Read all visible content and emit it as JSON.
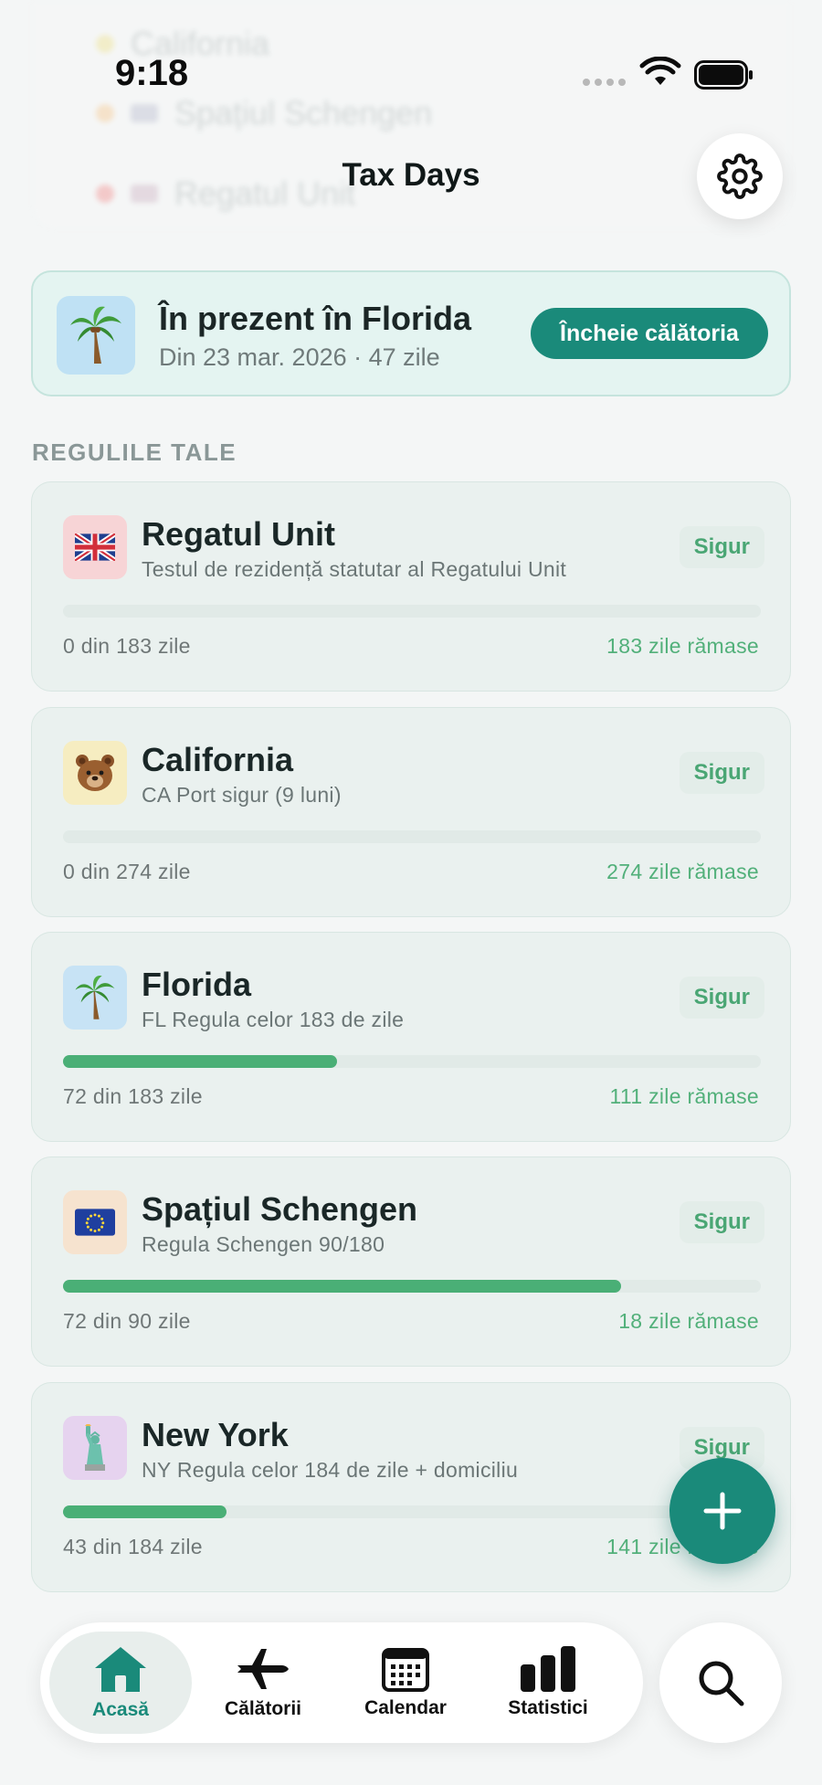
{
  "status_bar": {
    "time": "9:18"
  },
  "background_list": [
    {
      "name": "California",
      "value": ""
    },
    {
      "name": "Spațiul Schengen",
      "value": ""
    },
    {
      "name": "Regatul Unit",
      "value": ""
    }
  ],
  "header": {
    "title": "Tax Days"
  },
  "current": {
    "title": "În prezent în Florida",
    "subtitle": "Din 23 mar. 2026 · 47 zile",
    "end_button": "Încheie călătoria",
    "icon": "palm-tree-icon"
  },
  "section_title": "REGULILE TALE",
  "rules": [
    {
      "name": "Regatul Unit",
      "description": "Testul de rezidență statutar al Regatului Unit",
      "status": "Sigur",
      "count": "0 din 183 zile",
      "remaining": "183 zile rămase",
      "progress": 0,
      "icon": "uk-flag-icon",
      "icon_bg": "#f7d4d6"
    },
    {
      "name": "California",
      "description": "CA Port sigur (9 luni)",
      "status": "Sigur",
      "count": "0 din 274 zile",
      "remaining": "274 zile rămase",
      "progress": 0,
      "icon": "bear-icon",
      "icon_bg": "#f6edc1"
    },
    {
      "name": "Florida",
      "description": "FL Regula celor 183 de zile",
      "status": "Sigur",
      "count": "72 din 183 zile",
      "remaining": "111 zile rămase",
      "progress": 0.393,
      "icon": "palm-tree-icon",
      "icon_bg": "#c7e3f5"
    },
    {
      "name": "Spațiul Schengen",
      "description": "Regula Schengen 90/180",
      "status": "Sigur",
      "count": "72 din 90 zile",
      "remaining": "18 zile rămase",
      "progress": 0.8,
      "icon": "eu-flag-icon",
      "icon_bg": "#f6e3cf"
    },
    {
      "name": "New York",
      "description": "NY Regula celor 184 de zile + domiciliu",
      "status": "Sigur",
      "count": "43 din 184 zile",
      "remaining": "141 zile rămase",
      "progress": 0.234,
      "icon": "statue-of-liberty-icon",
      "icon_bg": "#e6d3ef"
    }
  ],
  "tabs": [
    {
      "label": "Acasă",
      "icon": "home-icon",
      "active": true
    },
    {
      "label": "Călătorii",
      "icon": "airplane-icon",
      "active": false
    },
    {
      "label": "Calendar",
      "icon": "calendar-icon",
      "active": false
    },
    {
      "label": "Statistici",
      "icon": "bar-chart-icon",
      "active": false
    }
  ],
  "colors": {
    "accent": "#1a8a7a",
    "safe": "#4aaf76",
    "background": "#f4f6f6"
  }
}
